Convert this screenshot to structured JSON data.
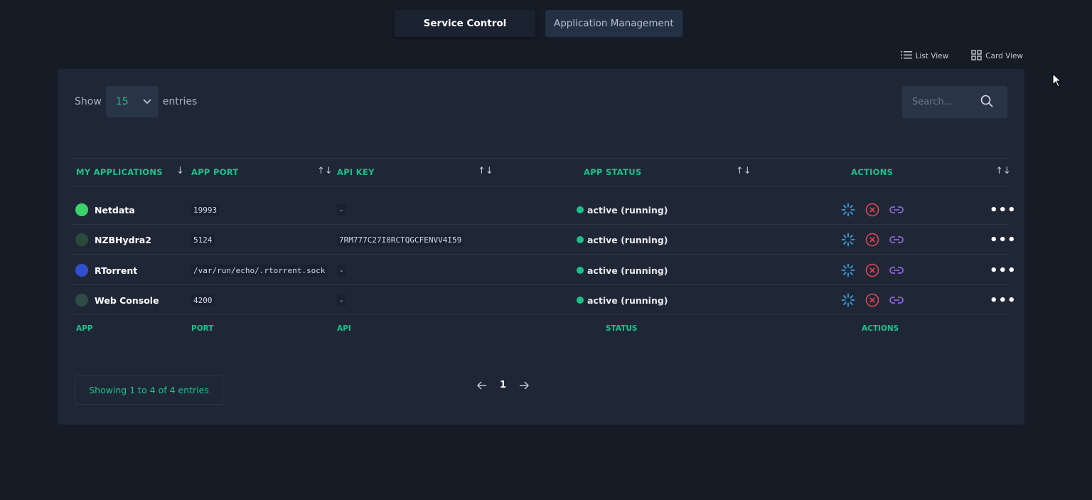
{
  "tabs": [
    {
      "label": "Service Control",
      "active": true
    },
    {
      "label": "Application Management",
      "active": false
    }
  ],
  "view_switch": {
    "list": "List View",
    "card": "Card View"
  },
  "controls": {
    "show_label": "Show",
    "entries_value": "15",
    "entries_label": "entries",
    "search_placeholder": "Search..."
  },
  "table": {
    "headers": [
      "MY APPLICATIONS",
      "APP PORT",
      "API KEY",
      "APP STATUS",
      "ACTIONS"
    ],
    "footers": [
      "APP",
      "PORT",
      "API",
      "STATUS",
      "ACTIONS"
    ],
    "rows": [
      {
        "name": "Netdata",
        "port": "19993",
        "api_key": "-",
        "status": "active (running)",
        "icon_color": "#3ad36a"
      },
      {
        "name": "NZBHydra2",
        "port": "5124",
        "api_key": "7RM777C27I0RCTQGCFENVV4I59",
        "status": "active (running)",
        "icon_color": "#2b4a3c"
      },
      {
        "name": "RTorrent",
        "port": "/var/run/echo/.rtorrent.sock",
        "api_key": "-",
        "status": "active (running)",
        "icon_color": "#2f4fd0"
      },
      {
        "name": "Web Console",
        "port": "4200",
        "api_key": "-",
        "status": "active (running)",
        "icon_color": "#2e4b44"
      }
    ]
  },
  "footer": {
    "info": "Showing 1 to 4 of 4 entries",
    "page": "1"
  },
  "colors": {
    "accent": "#1ec08a",
    "restart": "#3ba0e0",
    "stop": "#e0454f",
    "link": "#8e63d6"
  }
}
